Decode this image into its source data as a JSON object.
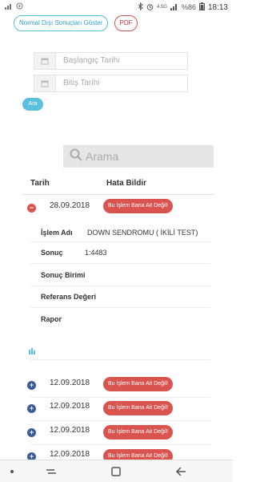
{
  "statusbar": {
    "battery": "%86",
    "time": "18:13",
    "network": "4.5G"
  },
  "toolbar": {
    "normal_disi_label": "Normal Dışı Sonuçları Göster",
    "pdf_label": "PDF"
  },
  "filters": {
    "start_placeholder": "Başlangıç Tarihi",
    "end_placeholder": "Bitiş Tarihi",
    "search_button_label": "Ara"
  },
  "search": {
    "placeholder": "Arama"
  },
  "table": {
    "headers": {
      "date": "Tarih",
      "report": "Hata Bildir"
    },
    "report_button_label": "Bu İşlem Bana Ait Değil!",
    "expanded": {
      "date": "28.09.2018",
      "islem_label": "İşlem Adı",
      "islem_value": "DOWN SENDROMU ( İKİLİ TEST)",
      "sonuc_label": "Sonuç",
      "sonuc_value": "1:4483",
      "birim_label": "Sonuç Birimi",
      "referans_label": "Referans Değeri",
      "rapor_label": "Rapor"
    },
    "rows": [
      {
        "date": "12.09.2018"
      },
      {
        "date": "12.09.2018"
      },
      {
        "date": "12.09.2018"
      },
      {
        "date": "12.09.2018"
      }
    ]
  }
}
